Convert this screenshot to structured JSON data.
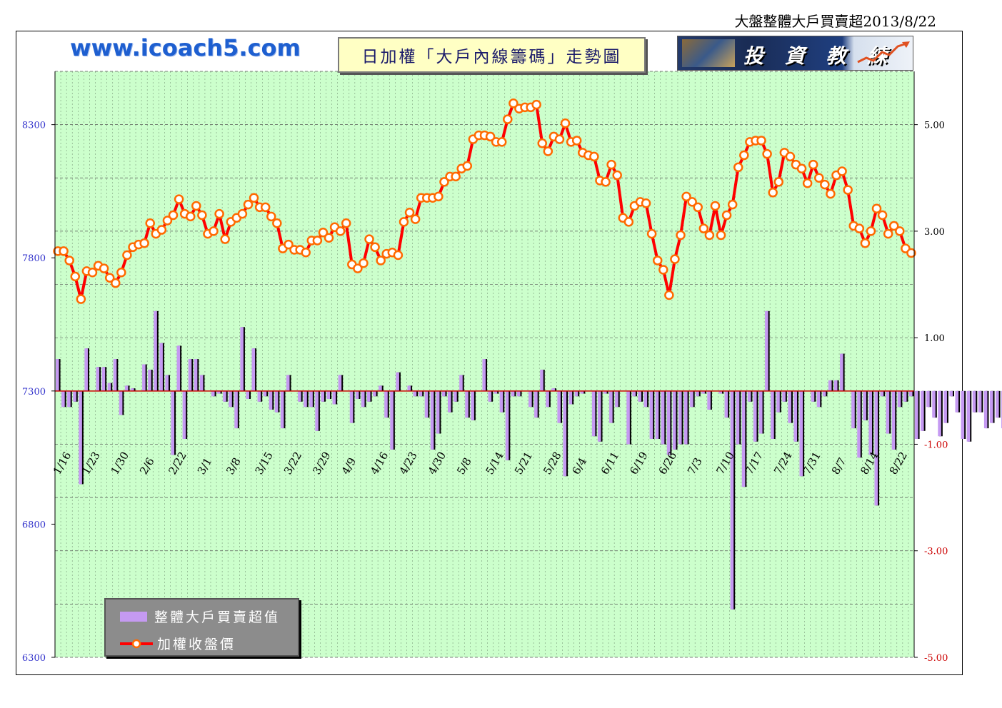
{
  "page_title": "大盤整體大戶買賣超2013/8/22",
  "site_url": "www.icoach5.com",
  "chart_title": "日加權「大戶內線籌碼」走勢圖",
  "logo_text": "投 資 教 練",
  "legend": {
    "bar_label": "整體大戶買賣超值",
    "line_label": "加權收盤價"
  },
  "colors": {
    "plot_bg": "#ccffcc",
    "bar": "#c59af2",
    "bar_shadow": "#000000",
    "line": "#ff0000",
    "marker_fill": "#ffffff",
    "marker_edge": "#ff6a00",
    "left_axis_text": "#3333cc",
    "right_axis_text": "#000000",
    "right_axis_neg_text": "#cc0000",
    "zero_line": "#cc0000"
  },
  "chart_data": {
    "type": "bar+line",
    "x_tick_labels": [
      "1/16",
      "1/23",
      "1/30",
      "2/6",
      "2/22",
      "3/1",
      "3/8",
      "3/15",
      "3/22",
      "3/29",
      "4/9",
      "4/16",
      "4/23",
      "4/30",
      "5/8",
      "5/14",
      "5/21",
      "5/28",
      "6/4",
      "6/11",
      "6/19",
      "6/26",
      "7/3",
      "7/10",
      "7/17",
      "7/24",
      "7/31",
      "8/7",
      "8/14",
      "8/22"
    ],
    "x_tick_index": [
      0,
      5,
      10,
      15,
      20,
      25,
      30,
      35,
      40,
      45,
      50,
      55,
      60,
      65,
      70,
      75,
      80,
      85,
      90,
      95,
      100,
      105,
      110,
      115,
      120,
      125,
      130,
      135,
      140,
      145
    ],
    "left_axis": {
      "min": 6300,
      "max": 8500,
      "ticks": [
        6300,
        6800,
        7300,
        7800,
        8300
      ],
      "tick_labels": [
        "6300",
        "6800",
        "7300",
        "7800",
        "8300"
      ]
    },
    "right_axis": {
      "min": -5,
      "max": 6,
      "ticks": [
        -5,
        -3,
        -1,
        1,
        3,
        5
      ],
      "tick_labels": [
        "-5.00",
        "-3.00",
        "-1.00",
        "1.00",
        "3.00",
        "5.00"
      ]
    },
    "series": [
      {
        "name": "加權收盤價",
        "type": "line",
        "axis": "left",
        "values": [
          7825,
          7825,
          7790,
          7730,
          7645,
          7750,
          7745,
          7770,
          7760,
          7725,
          7705,
          7745,
          7810,
          7840,
          7850,
          7855,
          7930,
          7890,
          7905,
          7940,
          7960,
          8020,
          7965,
          7955,
          7995,
          7960,
          7890,
          7900,
          7965,
          7870,
          7935,
          7950,
          7965,
          8000,
          8025,
          7990,
          7990,
          7955,
          7930,
          7835,
          7850,
          7830,
          7830,
          7820,
          7865,
          7865,
          7895,
          7875,
          7915,
          7900,
          7930,
          7775,
          7760,
          7780,
          7870,
          7840,
          7790,
          7815,
          7820,
          7810,
          7935,
          7970,
          7945,
          8025,
          8025,
          8025,
          8030,
          8085,
          8105,
          8105,
          8135,
          8145,
          8245,
          8260,
          8260,
          8255,
          8235,
          8235,
          8320,
          8380,
          8360,
          8365,
          8365,
          8375,
          8230,
          8200,
          8255,
          8245,
          8305,
          8235,
          8240,
          8195,
          8185,
          8180,
          8090,
          8085,
          8150,
          8110,
          7950,
          7935,
          7995,
          8010,
          8005,
          7890,
          7790,
          7755,
          7660,
          7795,
          7885,
          8030,
          8010,
          7990,
          7910,
          7885,
          7995,
          7885,
          7960,
          8000,
          8140,
          8185,
          8235,
          8240,
          8240,
          8190,
          8045,
          8085,
          8195,
          8180,
          8150,
          8135,
          8080,
          8150,
          8100,
          8075,
          8040,
          8110,
          8125,
          8055,
          7920,
          7910,
          7855,
          7900,
          7985,
          7960,
          7890,
          7920,
          7900,
          7835,
          7818
        ]
      },
      {
        "name": "整體大戶買賣超值",
        "type": "bar",
        "axis": "right",
        "values": [
          0.6,
          -0.3,
          -0.3,
          -0.2,
          -1.75,
          0.8,
          0.0,
          0.45,
          0.45,
          0.15,
          0.6,
          -0.45,
          0.1,
          0.05,
          0.0,
          0.5,
          0.4,
          1.5,
          0.9,
          0.3,
          -1.2,
          0.85,
          -0.9,
          0.6,
          0.6,
          0.3,
          0.0,
          -0.1,
          -0.05,
          -0.2,
          -0.3,
          -0.7,
          1.2,
          -0.15,
          0.8,
          -0.2,
          -0.1,
          -0.35,
          -0.4,
          -0.7,
          0.3,
          0.0,
          -0.2,
          -0.3,
          -0.3,
          -0.75,
          -0.2,
          -0.15,
          -0.25,
          0.3,
          0.0,
          -0.6,
          -0.15,
          -0.3,
          -0.2,
          -0.1,
          0.1,
          -0.5,
          -1.1,
          0.35,
          0.0,
          0.1,
          -0.1,
          -0.1,
          -0.5,
          -1.1,
          -0.8,
          -0.1,
          -0.4,
          -0.2,
          0.3,
          -0.5,
          -0.55,
          0.0,
          0.6,
          -0.2,
          -0.05,
          -0.4,
          -1.3,
          -0.1,
          -0.1,
          0.0,
          -0.3,
          -0.5,
          0.4,
          -0.3,
          0.05,
          -0.6,
          -1.6,
          -0.25,
          -0.1,
          -0.05,
          0.0,
          -0.85,
          -0.95,
          -0.05,
          -0.6,
          -0.3,
          0.0,
          -1.0,
          -0.1,
          -0.2,
          -0.3,
          -0.9,
          -0.9,
          -1.0,
          -1.2,
          -1.1,
          -1.0,
          -1.0,
          -0.3,
          -0.1,
          -0.05,
          -0.35,
          0.0,
          -0.05,
          -0.5,
          -4.1,
          -1.0,
          -1.8,
          -0.2,
          -0.95,
          -0.8,
          1.5,
          -0.9,
          -0.4,
          -0.2,
          -0.6,
          -0.95,
          -1.6,
          0.0,
          -0.2,
          -0.3,
          -0.1,
          0.2,
          0.2,
          0.7,
          0.0,
          -0.7,
          -1.25,
          -0.55,
          -1.2,
          -2.15,
          -0.1,
          -0.8,
          -1.1,
          -0.3,
          -0.2,
          -0.1,
          -0.9,
          -0.75,
          -0.3,
          -0.5,
          -0.85,
          -0.6,
          -0.1,
          -0.4,
          -0.9,
          -0.95,
          -0.4,
          -0.4,
          -0.7,
          -0.6,
          -0.5,
          -0.7,
          -0.4,
          -0.3,
          -0.35,
          0.65,
          -2.15
        ]
      }
    ],
    "grid": true
  }
}
